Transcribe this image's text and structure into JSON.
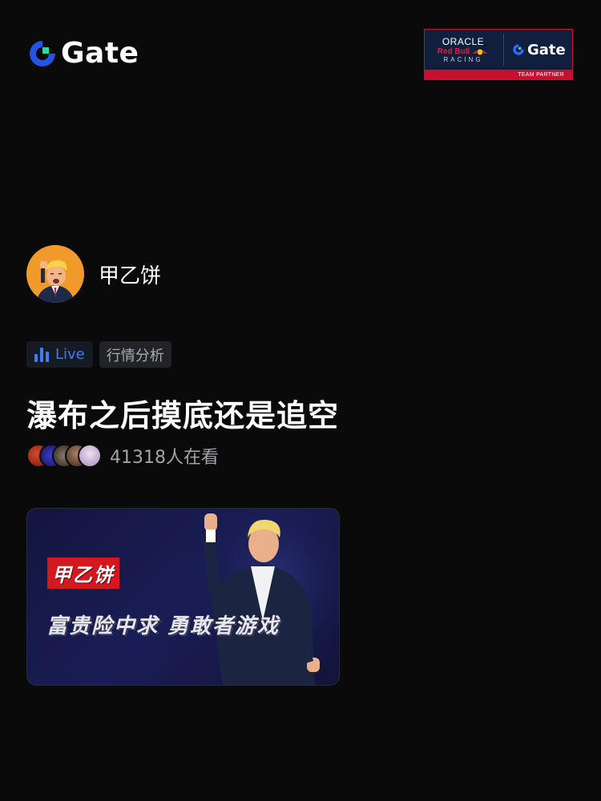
{
  "header": {
    "logo_text": "Gate",
    "logo_icon": "gate-logo-icon",
    "partner": {
      "oracle": "ORACLE",
      "redbull": "Red Bull",
      "racing": "RACING",
      "gate": "Gate",
      "label": "TEAM PARTNER"
    }
  },
  "host": {
    "name": "甲乙饼",
    "avatar_icon": "host-avatar"
  },
  "tags": {
    "live_label": "Live",
    "category": "行情分析"
  },
  "stream": {
    "title": "瀑布之后摸底还是追空",
    "viewer_count": "41318人在看"
  },
  "cover": {
    "name_banner": "甲乙饼",
    "slogan": "富贵险中求 勇敢者游戏"
  },
  "colors": {
    "background": "#0a0a0b",
    "accent_blue": "#3d7cf5",
    "logo_green": "#17e6a1",
    "brand_red": "#c8102e"
  }
}
